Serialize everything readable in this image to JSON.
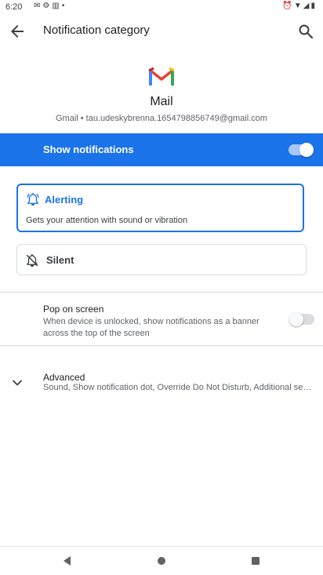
{
  "status_bar": {
    "time": "6:20",
    "left_icons": [
      "mail-icon",
      "settings-icon",
      "sim-icon",
      "dot-icon"
    ],
    "right_icons": [
      "alarm-icon",
      "wifi-icon",
      "signal-icon",
      "battery-icon"
    ]
  },
  "toolbar": {
    "title": "Notification category"
  },
  "app": {
    "name": "Mail",
    "account": "Gmail • tau.udeskybrenna.1654798856749@gmail.com"
  },
  "show_notifications": {
    "label": "Show notifications",
    "enabled": true
  },
  "options": {
    "alerting_title": "Alerting",
    "alerting_desc": "Gets your attention with sound or vibration",
    "silent_title": "Silent"
  },
  "pop_on_screen": {
    "title": "Pop on screen",
    "description": "When device is unlocked, show notifications as a banner across the top of the screen",
    "enabled": false
  },
  "advanced": {
    "title": "Advanced",
    "summary": "Sound, Show notification dot, Override Do Not Disturb, Additional settings"
  },
  "colors": {
    "accent": "#1a73e8",
    "toggle_on_track": "#a8c7fa",
    "divider": "#dadce0"
  }
}
